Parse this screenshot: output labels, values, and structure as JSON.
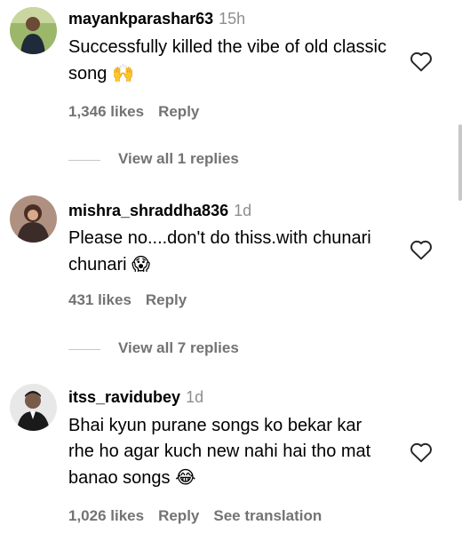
{
  "comments": [
    {
      "username": "mayankparashar63",
      "time": "15h",
      "text": "Successfully killed the vibe of old classic song",
      "emoji": "🙌",
      "likes": "1,346 likes",
      "reply": "Reply",
      "view_replies": "View all 1 replies"
    },
    {
      "username": "mishra_shraddha836",
      "time": "1d",
      "text": "Please no....don't do thiss.with chunari chunari",
      "emoji": "😱",
      "likes": "431 likes",
      "reply": "Reply",
      "view_replies": "View all 7 replies"
    },
    {
      "username": "itss_ravidubey",
      "time": "1d",
      "text": "Bhai kyun purane songs ko bekar kar rhe ho agar kuch new nahi hai tho mat banao songs",
      "emoji": "😂",
      "likes": "1,026 likes",
      "reply": "Reply",
      "translate": "See translation"
    }
  ],
  "icons": {
    "like": "heart-outline-icon"
  },
  "colors": {
    "secondary_text": "#737373",
    "timestamp": "#8e8e8e"
  }
}
